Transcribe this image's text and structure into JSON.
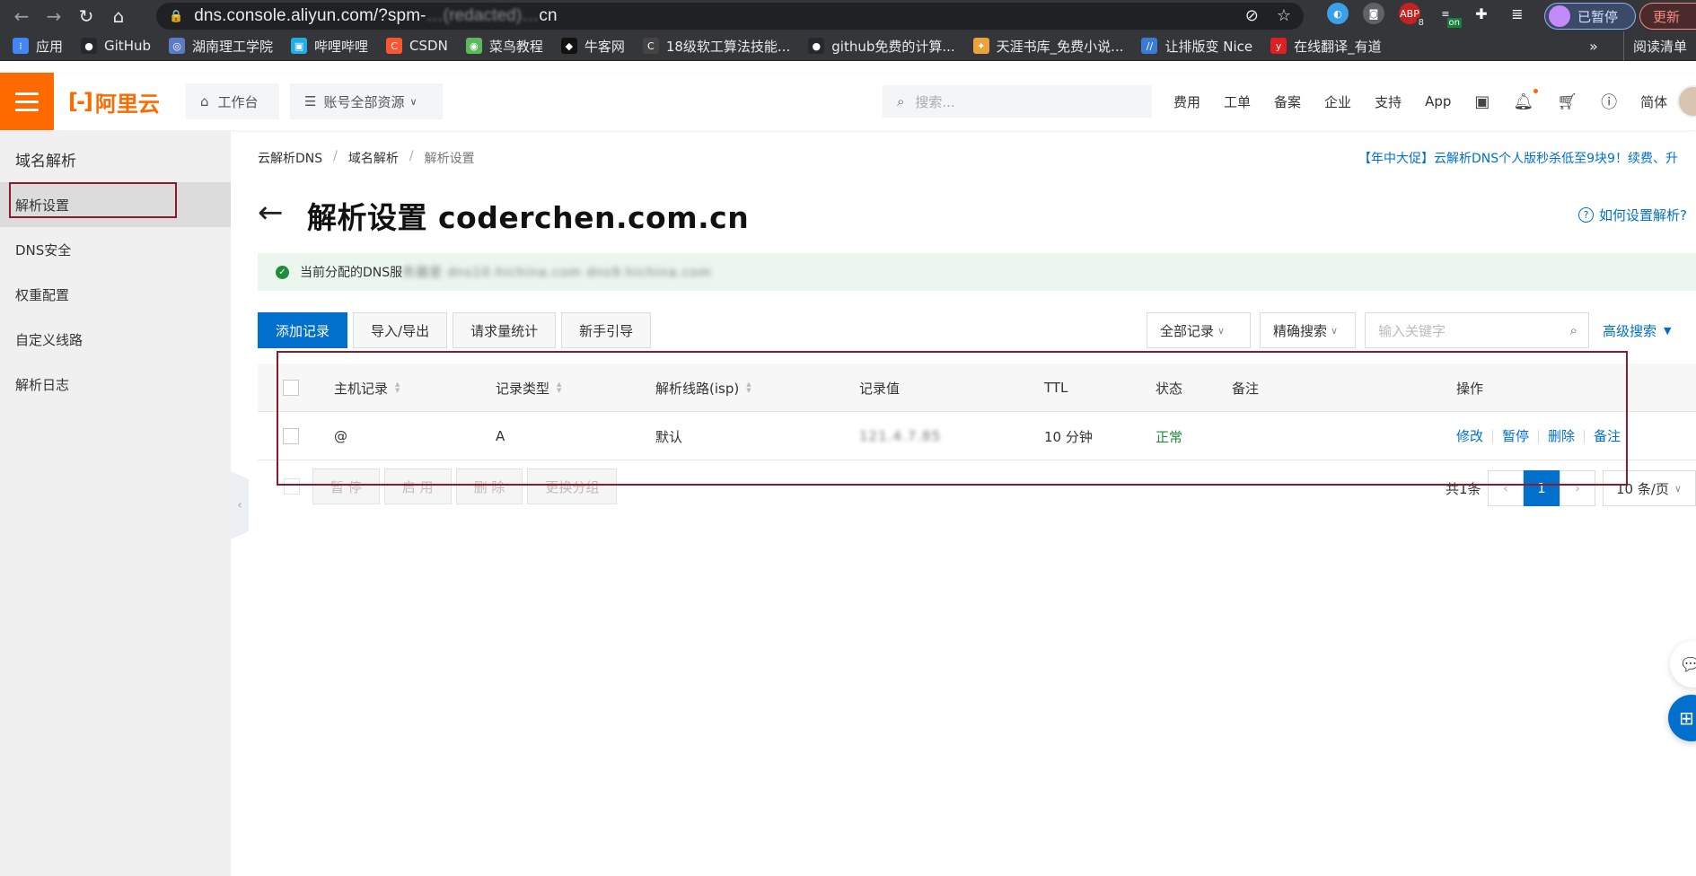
{
  "browser": {
    "url_prefix": "dns.console.aliyun.com/?spm-",
    "url_masked": "…(redacted)…",
    "url_suffix": "cn",
    "profile_label": "已暂停",
    "update_label": "更新",
    "abp_count": "8",
    "on_label": "on",
    "reading_list": "阅读清单",
    "more": "»"
  },
  "bookmarks": [
    {
      "label": "应用",
      "icon": "apps-grid-icon",
      "color": "#4285f4"
    },
    {
      "label": "GitHub",
      "icon": "github-icon",
      "color": "#24292e"
    },
    {
      "label": "湖南理工学院",
      "icon": "school-icon",
      "color": "#5b7cc4"
    },
    {
      "label": "哔哩哔哩",
      "icon": "bilibili-icon",
      "color": "#23ade5"
    },
    {
      "label": "CSDN",
      "icon": "csdn-icon",
      "color": "#fc5531"
    },
    {
      "label": "菜鸟教程",
      "icon": "runoob-icon",
      "color": "#5cb85c"
    },
    {
      "label": "牛客网",
      "icon": "nowcoder-icon",
      "color": "#111111"
    },
    {
      "label": "18级软工算法技能...",
      "icon": "c-icon",
      "color": "#444444"
    },
    {
      "label": "github免费的计算...",
      "icon": "github-icon",
      "color": "#24292e"
    },
    {
      "label": "天涯书库_免费小说...",
      "icon": "tianya-icon",
      "color": "#e8a33b"
    },
    {
      "label": "让排版变 Nice",
      "icon": "mdnice-icon",
      "color": "#3a7bd5"
    },
    {
      "label": "在线翻译_有道",
      "icon": "youdao-icon",
      "color": "#e02020"
    }
  ],
  "topnav": {
    "logo": "阿里云",
    "workbench": "工作台",
    "resources": "账号全部资源",
    "search_placeholder": "搜索...",
    "menu": [
      "费用",
      "工单",
      "备案",
      "企业",
      "支持",
      "App"
    ],
    "lang": "简体"
  },
  "sidebar": {
    "title": "域名解析",
    "items": [
      {
        "label": "解析设置",
        "active": true
      },
      {
        "label": "DNS安全",
        "active": false
      },
      {
        "label": "权重配置",
        "active": false
      },
      {
        "label": "自定义线路",
        "active": false
      },
      {
        "label": "解析日志",
        "active": false
      }
    ]
  },
  "breadcrumb": [
    "云解析DNS",
    "域名解析",
    "解析设置"
  ],
  "promo": "【年中大促】云解析DNS个人版秒杀低至9块9！续费、升",
  "page": {
    "title_prefix": "解析设置",
    "domain": "coderchen.com.cn",
    "howto": "如何设置解析?"
  },
  "notice": {
    "text": "当前分配的DNS服",
    "masked": "务器是 dns10.hichina.com dns9.hichina.com"
  },
  "toolbar": {
    "add": "添加记录",
    "import_export": "导入/导出",
    "stats": "请求量统计",
    "guide": "新手引导",
    "filter_all": "全部记录",
    "precise": "精确搜索",
    "keyword_placeholder": "输入关键字",
    "advanced": "高级搜索"
  },
  "table": {
    "columns": [
      "主机记录",
      "记录类型",
      "解析线路(isp)",
      "记录值",
      "TTL",
      "状态",
      "备注",
      "操作"
    ],
    "rows": [
      {
        "host": "@",
        "type": "A",
        "line": "默认",
        "value": "121.4.7.85",
        "ttl": "10 分钟",
        "status": "正常",
        "note": "",
        "actions": [
          "修改",
          "暂停",
          "删除",
          "备注"
        ]
      }
    ]
  },
  "bulk": {
    "buttons": [
      "暂 停",
      "启 用",
      "删 除",
      "更换分组"
    ]
  },
  "pagination": {
    "total": "共1条",
    "prev": "‹",
    "current": "1",
    "next": "›",
    "page_size": "10 条/页"
  },
  "colors": {
    "brand_orange": "#ff6a00",
    "primary_blue": "#0070cc",
    "highlight_box": "#8b1a2c",
    "status_green": "#1e8e3e"
  }
}
